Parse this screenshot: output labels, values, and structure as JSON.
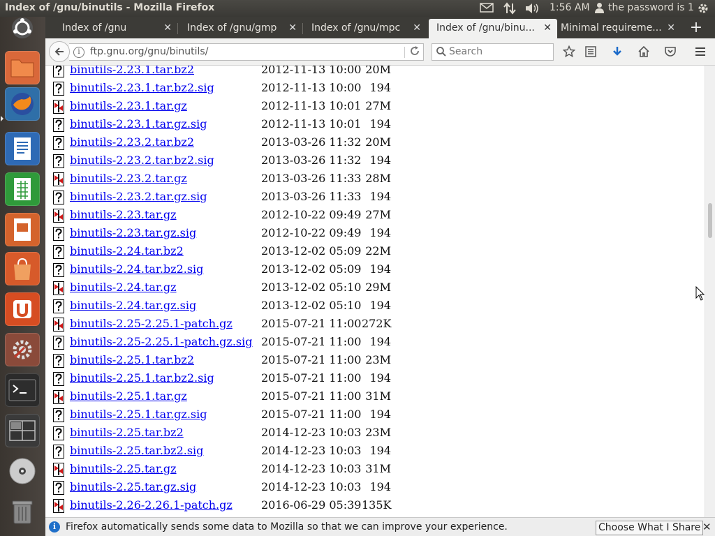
{
  "panel": {
    "window_title": "Index of /gnu/binutils - Mozilla Firefox",
    "time": "1:56 AM",
    "user": "the password is 1"
  },
  "tabs": [
    {
      "label": "Index of /gnu"
    },
    {
      "label": "Index of /gnu/gmp"
    },
    {
      "label": "Index of /gnu/mpc"
    },
    {
      "label": "Index of /gnu/binu..."
    },
    {
      "label": "Minimal requireme..."
    }
  ],
  "tab_close_glyph": "✕",
  "new_tab_glyph": "+",
  "navbar": {
    "url": "ftp.gnu.org/gnu/binutils/",
    "search_placeholder": "Search"
  },
  "files": [
    {
      "name": "binutils-2.23.1.tar.bz2",
      "date": "2012-11-13 10:00",
      "size": "20M",
      "type": "unknown"
    },
    {
      "name": "binutils-2.23.1.tar.bz2.sig",
      "date": "2012-11-13 10:00",
      "size": "194",
      "type": "unknown"
    },
    {
      "name": "binutils-2.23.1.tar.gz",
      "date": "2012-11-13 10:01",
      "size": "27M",
      "type": "compressed"
    },
    {
      "name": "binutils-2.23.1.tar.gz.sig",
      "date": "2012-11-13 10:01",
      "size": "194",
      "type": "unknown"
    },
    {
      "name": "binutils-2.23.2.tar.bz2",
      "date": "2013-03-26 11:32",
      "size": "20M",
      "type": "unknown"
    },
    {
      "name": "binutils-2.23.2.tar.bz2.sig",
      "date": "2013-03-26 11:32",
      "size": "194",
      "type": "unknown"
    },
    {
      "name": "binutils-2.23.2.tar.gz",
      "date": "2013-03-26 11:33",
      "size": "28M",
      "type": "compressed"
    },
    {
      "name": "binutils-2.23.2.tar.gz.sig",
      "date": "2013-03-26 11:33",
      "size": "194",
      "type": "unknown"
    },
    {
      "name": "binutils-2.23.tar.gz",
      "date": "2012-10-22 09:49",
      "size": "27M",
      "type": "compressed"
    },
    {
      "name": "binutils-2.23.tar.gz.sig",
      "date": "2012-10-22 09:49",
      "size": "194",
      "type": "unknown"
    },
    {
      "name": "binutils-2.24.tar.bz2",
      "date": "2013-12-02 05:09",
      "size": "22M",
      "type": "unknown"
    },
    {
      "name": "binutils-2.24.tar.bz2.sig",
      "date": "2013-12-02 05:09",
      "size": "194",
      "type": "unknown"
    },
    {
      "name": "binutils-2.24.tar.gz",
      "date": "2013-12-02 05:10",
      "size": "29M",
      "type": "compressed"
    },
    {
      "name": "binutils-2.24.tar.gz.sig",
      "date": "2013-12-02 05:10",
      "size": "194",
      "type": "unknown"
    },
    {
      "name": "binutils-2.25-2.25.1-patch.gz",
      "date": "2015-07-21 11:00",
      "size": "272K",
      "type": "compressed"
    },
    {
      "name": "binutils-2.25-2.25.1-patch.gz.sig",
      "date": "2015-07-21 11:00",
      "size": "194",
      "type": "unknown"
    },
    {
      "name": "binutils-2.25.1.tar.bz2",
      "date": "2015-07-21 11:00",
      "size": "23M",
      "type": "unknown"
    },
    {
      "name": "binutils-2.25.1.tar.bz2.sig",
      "date": "2015-07-21 11:00",
      "size": "194",
      "type": "unknown"
    },
    {
      "name": "binutils-2.25.1.tar.gz",
      "date": "2015-07-21 11:00",
      "size": "31M",
      "type": "compressed"
    },
    {
      "name": "binutils-2.25.1.tar.gz.sig",
      "date": "2015-07-21 11:00",
      "size": "194",
      "type": "unknown"
    },
    {
      "name": "binutils-2.25.tar.bz2",
      "date": "2014-12-23 10:03",
      "size": "23M",
      "type": "unknown"
    },
    {
      "name": "binutils-2.25.tar.bz2.sig",
      "date": "2014-12-23 10:03",
      "size": "194",
      "type": "unknown"
    },
    {
      "name": "binutils-2.25.tar.gz",
      "date": "2014-12-23 10:03",
      "size": "31M",
      "type": "compressed"
    },
    {
      "name": "binutils-2.25.tar.gz.sig",
      "date": "2014-12-23 10:03",
      "size": "194",
      "type": "unknown"
    },
    {
      "name": "binutils-2.26-2.26.1-patch.gz",
      "date": "2016-06-29 05:39",
      "size": "135K",
      "type": "compressed"
    }
  ],
  "notification": {
    "text": "Firefox automatically sends some data to Mozilla so that we can improve your experience.",
    "button": "Choose What I Share",
    "close_glyph": "✕"
  },
  "launcher_items": [
    "ubuntu-dash",
    "files",
    "firefox",
    "writer",
    "calc",
    "impress",
    "software-center",
    "ubuntu-one",
    "system-settings",
    "terminal",
    "workspace-switcher",
    "dvd",
    "trash"
  ]
}
